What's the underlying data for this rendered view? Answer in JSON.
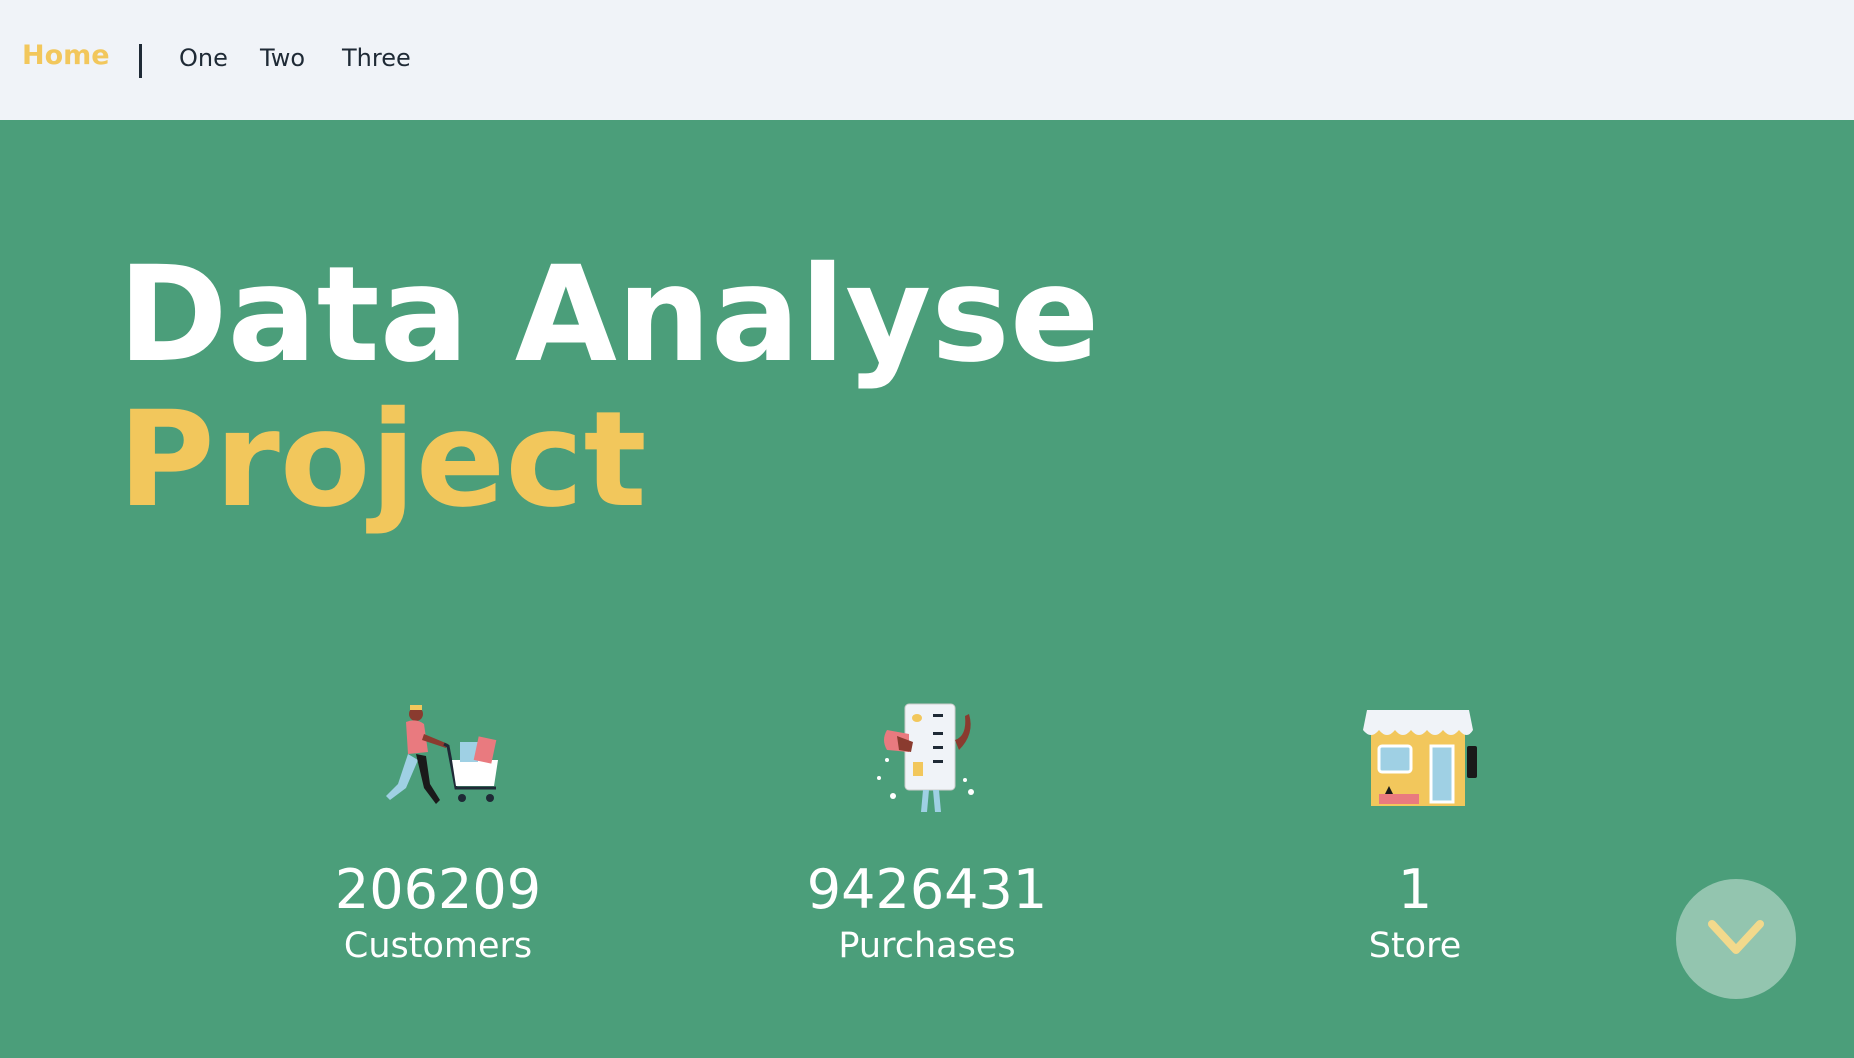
{
  "nav": {
    "home_label": "Home",
    "links": [
      {
        "label": "One"
      },
      {
        "label": "Two"
      },
      {
        "label": "Three"
      }
    ]
  },
  "hero": {
    "title_line1": "Data Analyse",
    "title_line2": "Project"
  },
  "stats": [
    {
      "value": "206209",
      "label": "Customers",
      "icon": "shopping-cart-person-icon"
    },
    {
      "value": "9426431",
      "label": "Purchases",
      "icon": "credit-card-person-icon"
    },
    {
      "value": "1",
      "label": "Store",
      "icon": "storefront-icon"
    }
  ],
  "scroll_button": {
    "icon": "chevron-down-icon"
  },
  "colors": {
    "nav_background": "#f0f3f8",
    "hero_background": "#4b9e7a",
    "accent_yellow": "#f2c75c",
    "text_white": "#ffffff",
    "text_dark": "#1f2a36"
  }
}
